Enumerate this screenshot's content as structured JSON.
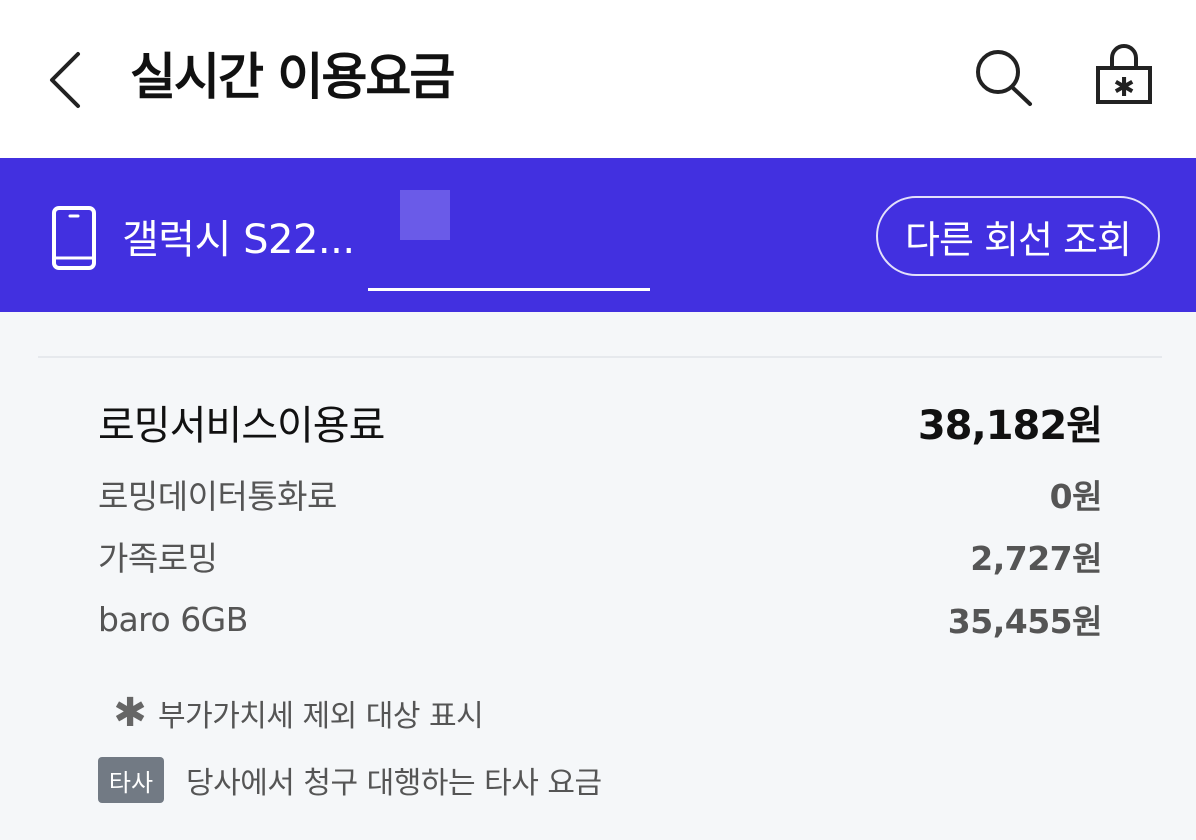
{
  "header": {
    "title": "실시간 이용요금",
    "icons": {
      "back": "chevron-left-icon",
      "search": "search-icon",
      "lock": "lock-icon"
    }
  },
  "line_bar": {
    "background_color": "#4230e0",
    "device_name": "갤럭시 S22...",
    "other_line_button_label": "다른 회선 조회"
  },
  "fees": {
    "main": {
      "label": "로밍서비스이용료",
      "amount": "38,182원"
    },
    "items": [
      {
        "label": "로밍데이터통화료",
        "amount": "0원"
      },
      {
        "label": "가족로밍",
        "amount": "2,727원"
      },
      {
        "label": "baro 6GB",
        "amount": "35,455원"
      }
    ]
  },
  "legend": {
    "vat_symbol": "✱",
    "vat_text": "부가가치세 제외 대상 표시",
    "other_carrier_badge": "타사",
    "other_carrier_text": "당사에서 청구 대행하는 타사 요금"
  }
}
